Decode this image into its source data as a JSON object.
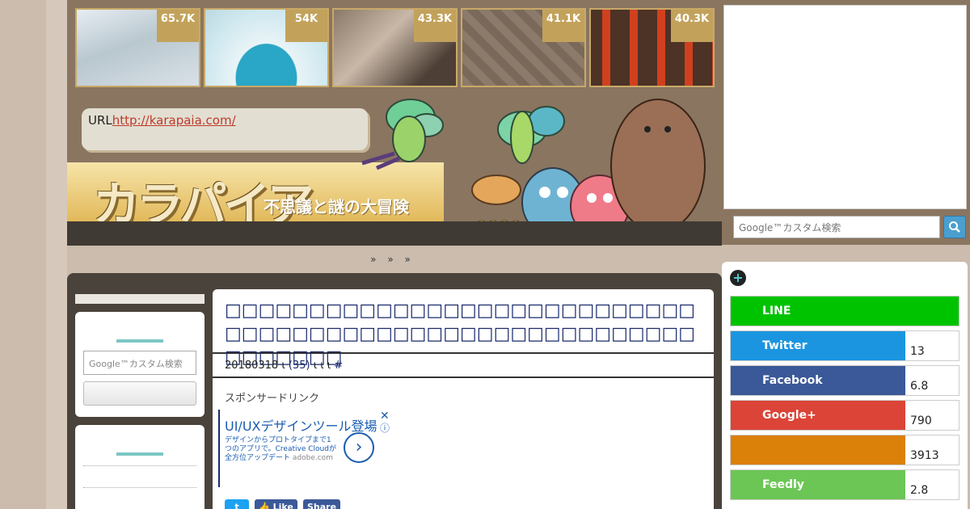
{
  "thumbnails": [
    {
      "count": "65.7K",
      "colors": [
        "#b9c7cf",
        "#e9eef2"
      ]
    },
    {
      "count": "54K",
      "colors": [
        "#3aa7c4",
        "#e9f4f7"
      ]
    },
    {
      "count": "43.3K",
      "colors": [
        "#6b5a4c",
        "#c9b8a8"
      ]
    },
    {
      "count": "41.1K",
      "colors": [
        "#8c7a6a",
        "#5a4b40"
      ]
    },
    {
      "count": "40.3K",
      "colors": [
        "#c0391e",
        "#4c3326"
      ]
    }
  ],
  "url_box": {
    "label": "URL",
    "link": "http://karapaia.com/"
  },
  "logo": {
    "name": "カラパイア",
    "tagline": "不思議と謎の大冒険"
  },
  "nav": {
    "items": [
      "»",
      "»",
      "»"
    ]
  },
  "sidebar": {
    "search_placeholder": "Google™カスタム検索"
  },
  "right": {
    "search_placeholder": "Google™カスタム検索",
    "search_icon": "search-icon"
  },
  "article": {
    "title": "□□□□□□□□□□□□□□□□□□□□□□□□□□□□□□□□□□□□□□□□□□□□□□□□□□□□□□□□□□□□□□□",
    "meta_date": "20180318",
    "meta_sep": "ι",
    "meta_comments": "(35)",
    "meta_tail": "ι ι ι",
    "meta_hash": "#",
    "sponsor": "スポンサードリンク",
    "ad_headline": "UI/UXデザインツール登場",
    "ad_body": "デザインからプロトタイプまで1つのアプリで。Creative Cloudが全方位アップデート",
    "ad_source": "adobe.com",
    "ad_arrow": "›",
    "ad_close": "✕",
    "ad_info": "ⓘ",
    "share_tw": "t",
    "share_like": "Like",
    "share_share": "Share"
  },
  "share_panel": {
    "plus": "+",
    "rows": [
      {
        "label": "LINE",
        "count": "",
        "color": "#00c300"
      },
      {
        "label": "Twitter",
        "count": "13",
        "color": "#1b95e0"
      },
      {
        "label": "Facebook",
        "count": "6.8",
        "color": "#3b5998"
      },
      {
        "label": "Google+",
        "count": "790",
        "color": "#db4437"
      },
      {
        "label": "",
        "count": "3913",
        "color": "#db8008"
      },
      {
        "label": "Feedly",
        "count": "2.8",
        "color": "#6cc655"
      }
    ]
  }
}
